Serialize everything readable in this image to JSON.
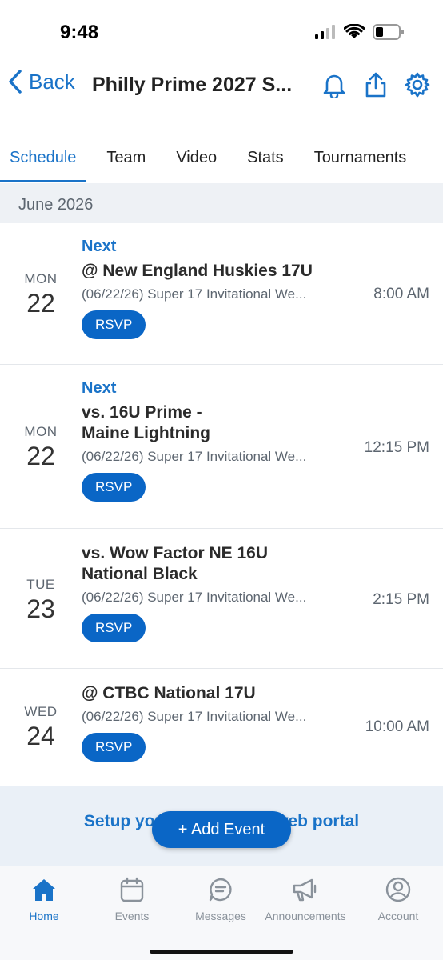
{
  "status_bar": {
    "time": "9:48"
  },
  "nav": {
    "back_label": "Back",
    "title": "Philly Prime 2027 S..."
  },
  "tabs": [
    {
      "label": "Schedule",
      "active": true
    },
    {
      "label": "Team"
    },
    {
      "label": "Video"
    },
    {
      "label": "Stats"
    },
    {
      "label": "Tournaments"
    }
  ],
  "month_header": "June 2026",
  "events": [
    {
      "dow": "MON",
      "day": "22",
      "next": "Next",
      "opponent": "@ New England Huskies 17U",
      "subtitle": "(06/22/26) Super 17 Invitational We...",
      "rsvp": "RSVP",
      "time": "8:00 AM"
    },
    {
      "dow": "MON",
      "day": "22",
      "next": "Next",
      "opponent": "vs. 16U Prime - Maine Lightning",
      "subtitle": "(06/22/26) Super 17 Invitational We...",
      "rsvp": "RSVP",
      "time": "12:15 PM"
    },
    {
      "dow": "TUE",
      "day": "23",
      "opponent": "vs. Wow Factor NE 16U National Black",
      "subtitle": "(06/22/26) Super 17 Invitational We...",
      "rsvp": "RSVP",
      "time": "2:15 PM"
    },
    {
      "dow": "WED",
      "day": "24",
      "opponent": "@ CTBC National 17U",
      "subtitle": "(06/22/26) Super 17 Invitational We...",
      "rsvp": "RSVP",
      "time": "10:00 AM"
    }
  ],
  "setup_banner": "Setup your team on the web portal",
  "add_event_label": "+ Add Event",
  "tabbar": [
    {
      "label": "Home",
      "icon": "home-icon",
      "active": true
    },
    {
      "label": "Events",
      "icon": "calendar-icon"
    },
    {
      "label": "Messages",
      "icon": "chat-icon"
    },
    {
      "label": "Announcements",
      "icon": "megaphone-icon"
    },
    {
      "label": "Account",
      "icon": "user-icon"
    }
  ],
  "colors": {
    "accent": "#1a73c8",
    "button": "#0a66c6",
    "muted": "#5d6670",
    "band": "#eef1f5"
  }
}
